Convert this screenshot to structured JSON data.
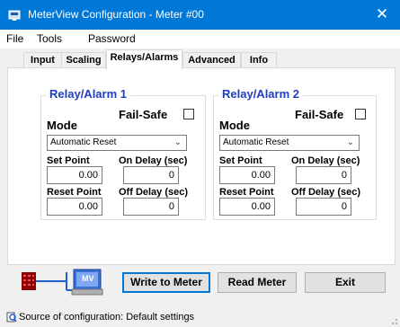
{
  "window": {
    "title": "MeterView Configuration - Meter #00",
    "close_glyph": "✕"
  },
  "menu": {
    "file": "File",
    "tools": "Tools",
    "password": "Password"
  },
  "tabs": {
    "input": "Input",
    "scaling": "Scaling",
    "relays": "Relays/Alarms",
    "advanced": "Advanced",
    "info": "Info",
    "active": "Relays/Alarms"
  },
  "relay1": {
    "title": "Relay/Alarm 1",
    "fail_safe_label": "Fail-Safe",
    "fail_safe_checked": false,
    "mode_label": "Mode",
    "mode_value": "Automatic Reset",
    "set_point_label": "Set Point",
    "set_point_value": "0.00",
    "on_delay_label": "On Delay (sec)",
    "on_delay_value": "0",
    "reset_point_label": "Reset Point",
    "reset_point_value": "0.00",
    "off_delay_label": "Off Delay (sec)",
    "off_delay_value": "0"
  },
  "relay2": {
    "title": "Relay/Alarm 2",
    "fail_safe_label": "Fail-Safe",
    "fail_safe_checked": false,
    "mode_label": "Mode",
    "mode_value": "Automatic Reset",
    "set_point_label": "Set Point",
    "set_point_value": "0.00",
    "on_delay_label": "On Delay (sec)",
    "on_delay_value": "0",
    "reset_point_label": "Reset Point",
    "reset_point_value": "0.00",
    "off_delay_label": "Off Delay (sec)",
    "off_delay_value": "0"
  },
  "buttons": {
    "write": "Write to Meter",
    "read": "Read Meter",
    "exit": "Exit"
  },
  "graphic": {
    "monitor_text": "MV"
  },
  "status": {
    "text": "Source of configuration: Default settings"
  },
  "colors": {
    "titlebar": "#0078d7",
    "group_title": "#1f3fbf",
    "default_button_border": "#0078d7"
  }
}
